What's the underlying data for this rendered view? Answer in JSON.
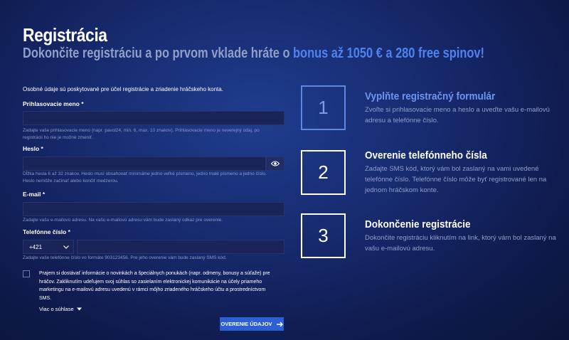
{
  "header": {
    "title": "Registrácia",
    "subtitle_prefix": "Dokončite registráciu a po prvom vklade hráte o ",
    "subtitle_bonus": "bonus až 1050 € a 280 free spinov!"
  },
  "form": {
    "intro": "Osobné údaje sú poskytované pre účel registrácie a zriadenie hráčskeho konta.",
    "username": {
      "label": "Prihlasovacie meno *",
      "value": "",
      "help": "Zadajte vaše prihlasovacie meno (napr. pavol24, min. 6, max. 10 znakov). Prihlasovacie meno je neverejný údaj, po registrácii ho nie je možné zmeniť."
    },
    "password": {
      "label": "Heslo *",
      "value": "",
      "help": "Dĺžka hesla 6 až 32 znakov. Heslo musí obsahovať minimálne jedno veľké písmeno, jedno malé písmeno a jedno číslo. Heslo nemôže začínať alebo končiť medzerou."
    },
    "email": {
      "label": "E-mail *",
      "value": "",
      "help": "Zadajte vašu e-mailovú adresu. Na vašu e-mailovú adresu vám bude zaslaný odkaz  pre overenie."
    },
    "phone": {
      "label": "Telefónne číslo *",
      "prefix": "+421",
      "value": "",
      "help": "Zadajte vaše telefónne číslo vo formáte 903123456. Pre jeho overenie vám bude zaslaný SMS kód."
    },
    "consent": {
      "checked": false,
      "text": "Prajem si dostávať informácie o novinkách a špeciálnych ponukách (napr. odmeny, bonusy a súťaže) pre hráčov. Zakliknutím udeľujem svoj súhlas so zasielaním elektronickej komunikácie na účely priameho marketingu na e-mailovú adresu uvedenú v rámci môjho zriadeného hráčskeho účtu a prostredníctvom SMS.",
      "more_label": "Viac o súhlase"
    },
    "submit_label": "OVERENIE ÚDAJOV"
  },
  "steps": [
    {
      "number": "1",
      "title": "Vyplňte registračný formulár",
      "desc": "Zvoľte si prihlasovacie meno a heslo a uveďte vašu e-mailovú adresu a telefónne číslo."
    },
    {
      "number": "2",
      "title": "Overenie telefónneho čísla",
      "desc": "Zadajte SMS kód, ktorý vám bol zaslaný na vami uvedené telefónne číslo. Telefónne číslo môže byť registrované len na jednom hráčskom konte."
    },
    {
      "number": "3",
      "title": "Dokončenie registrácie",
      "desc": "Dokončite registráciu kliknutím na link, ktorý vám bol zaslaný na vašu e-mailovú adresu."
    }
  ],
  "colors": {
    "accent": "#4f82ee",
    "button": "#2d5fd4",
    "muted_text": "#8f9fc9",
    "input_bg": "#1a2458"
  },
  "icons": {
    "password_toggle": "eye-icon",
    "prefix_dropdown": "chevron-down-icon",
    "more_toggle": "caret-down-icon",
    "submit_arrow": "arrow-right-icon"
  }
}
